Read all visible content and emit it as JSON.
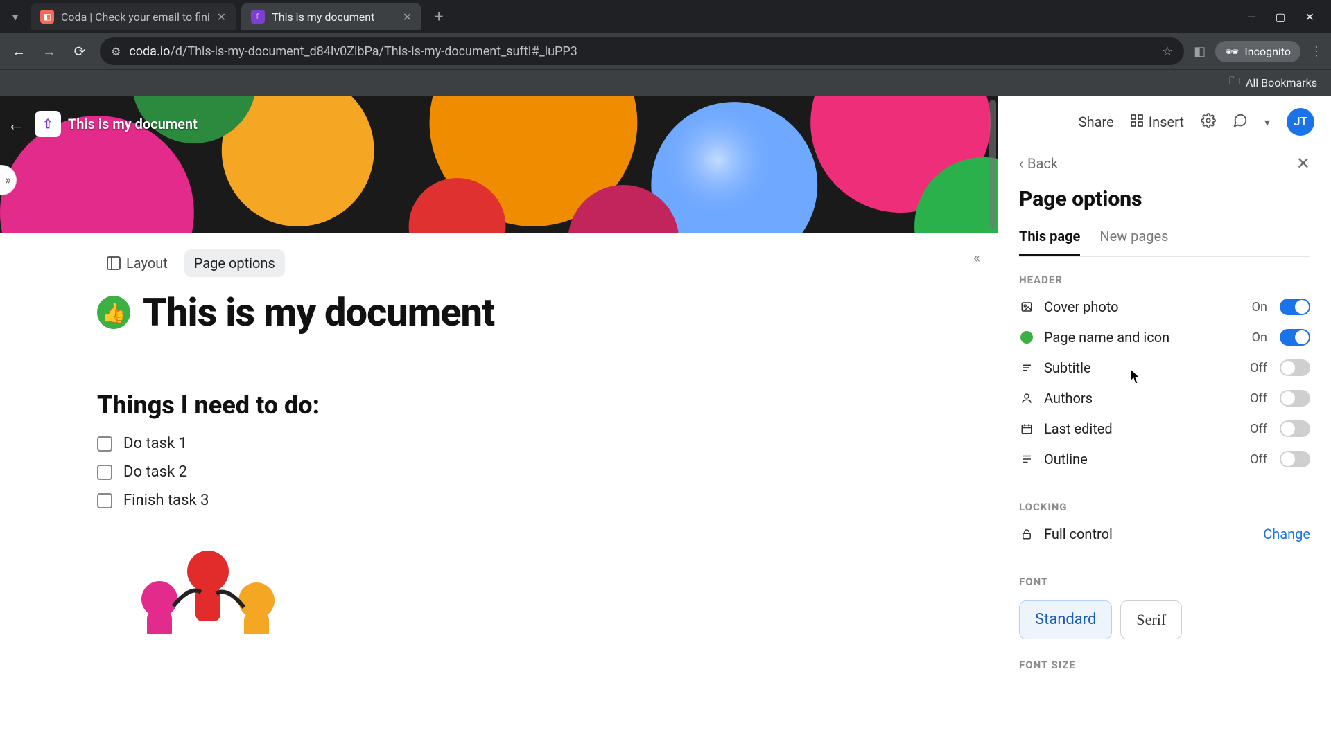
{
  "browser": {
    "tabs": [
      {
        "title": "Coda | Check your email to fini",
        "active": false
      },
      {
        "title": "This is my document",
        "active": true
      }
    ],
    "url_domain": "coda.io",
    "url_path": "/d/This-is-my-document_d84lv0ZibPa/This-is-my-document_suftI#_luPP3",
    "incognito": "Incognito",
    "all_bookmarks": "All Bookmarks"
  },
  "top_actions": {
    "share": "Share",
    "insert": "Insert",
    "avatar": "JT"
  },
  "doc": {
    "chip_title": "This is my document",
    "toolbar": {
      "layout": "Layout",
      "page_options": "Page options"
    },
    "title": "This is my document",
    "section_title": "Things I need to do:",
    "tasks": [
      "Do task 1",
      "Do task 2",
      "Finish task 3"
    ]
  },
  "panel": {
    "back": "Back",
    "title": "Page options",
    "tabs": {
      "this_page": "This page",
      "new_pages": "New pages"
    },
    "groups": {
      "header_label": "HEADER",
      "locking_label": "LOCKING",
      "font_label": "FONT",
      "font_size_label": "FONT SIZE"
    },
    "header_options": [
      {
        "icon": "image",
        "label": "Cover photo",
        "state": "On",
        "on": true
      },
      {
        "icon": "green-dot",
        "label": "Page name and icon",
        "state": "On",
        "on": true
      },
      {
        "icon": "subtitle",
        "label": "Subtitle",
        "state": "Off",
        "on": false
      },
      {
        "icon": "authors",
        "label": "Authors",
        "state": "Off",
        "on": false
      },
      {
        "icon": "calendar",
        "label": "Last edited",
        "state": "Off",
        "on": false
      },
      {
        "icon": "outline",
        "label": "Outline",
        "state": "Off",
        "on": false
      }
    ],
    "locking": {
      "label": "Full control",
      "action": "Change"
    },
    "font": {
      "standard": "Standard",
      "serif": "Serif"
    }
  }
}
